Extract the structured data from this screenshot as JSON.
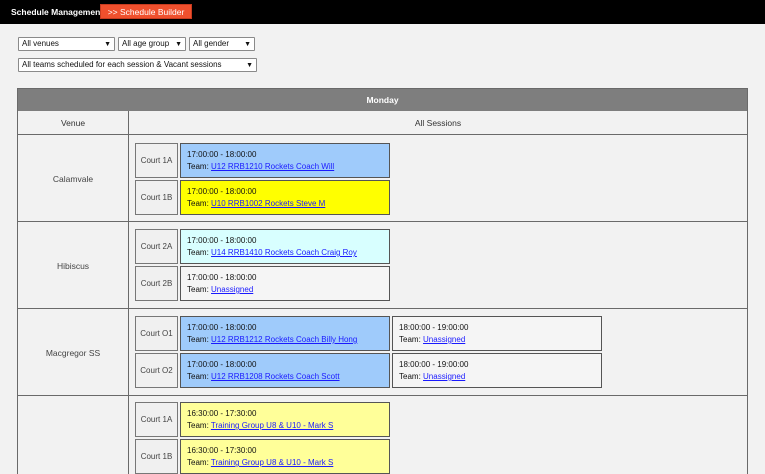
{
  "header": {
    "title": "Schedule Management",
    "builder_button": ">> Schedule Builder"
  },
  "filters": {
    "venues": "All venues",
    "age_group": "All age group",
    "gender": "All gender",
    "scheduled": "All teams scheduled for each session & Vacant sessions"
  },
  "grid": {
    "day": "Monday",
    "venue_header": "Venue",
    "sessions_header": "All Sessions",
    "team_prefix": "Team:",
    "venues": [
      {
        "name": "Calamvale",
        "courts": [
          {
            "court": "Court 1A",
            "sessions": [
              {
                "time": "17:00:00 - 18:00:00",
                "team": "U12 RRB1210 Rockets Coach Will",
                "color": "#9fcbfb"
              }
            ]
          },
          {
            "court": "Court 1B",
            "sessions": [
              {
                "time": "17:00:00 - 18:00:00",
                "team": "U10 RRB1002 Rockets Steve M",
                "color": "#ffff00"
              }
            ]
          }
        ]
      },
      {
        "name": "Hibiscus",
        "courts": [
          {
            "court": "Court 2A",
            "sessions": [
              {
                "time": "17:00:00 - 18:00:00",
                "team": "U14 RRB1410 Rockets Coach Craig Roy",
                "color": "#d8ffff"
              }
            ]
          },
          {
            "court": "Court 2B",
            "sessions": [
              {
                "time": "17:00:00 - 18:00:00",
                "team": "Unassigned",
                "color": "#f5f5f5"
              }
            ]
          }
        ]
      },
      {
        "name": "Macgregor SS",
        "courts": [
          {
            "court": "Court O1",
            "sessions": [
              {
                "time": "17:00:00 - 18:00:00",
                "team": "U12 RRB1212 Rockets Coach Billy Hong",
                "color": "#9fcbfb"
              },
              {
                "time": "18:00:00 - 19:00:00",
                "team": "Unassigned",
                "color": "#f5f5f5"
              }
            ]
          },
          {
            "court": "Court O2",
            "sessions": [
              {
                "time": "17:00:00 - 18:00:00",
                "team": "U12 RRB1208 Rockets Coach Scott",
                "color": "#9fcbfb"
              },
              {
                "time": "18:00:00 - 19:00:00",
                "team": "Unassigned",
                "color": "#f5f5f5"
              }
            ]
          }
        ]
      },
      {
        "name": "",
        "courts": [
          {
            "court": "Court 1A",
            "sessions": [
              {
                "time": "16:30:00 - 17:30:00",
                "team": "Training Group U8 & U10 - Mark S",
                "color": "#ffff99"
              }
            ]
          },
          {
            "court": "Court 1B",
            "sessions": [
              {
                "time": "16:30:00 - 17:30:00",
                "team": "Training Group U8 & U10 - Mark S",
                "color": "#ffff99"
              }
            ]
          }
        ]
      }
    ]
  }
}
